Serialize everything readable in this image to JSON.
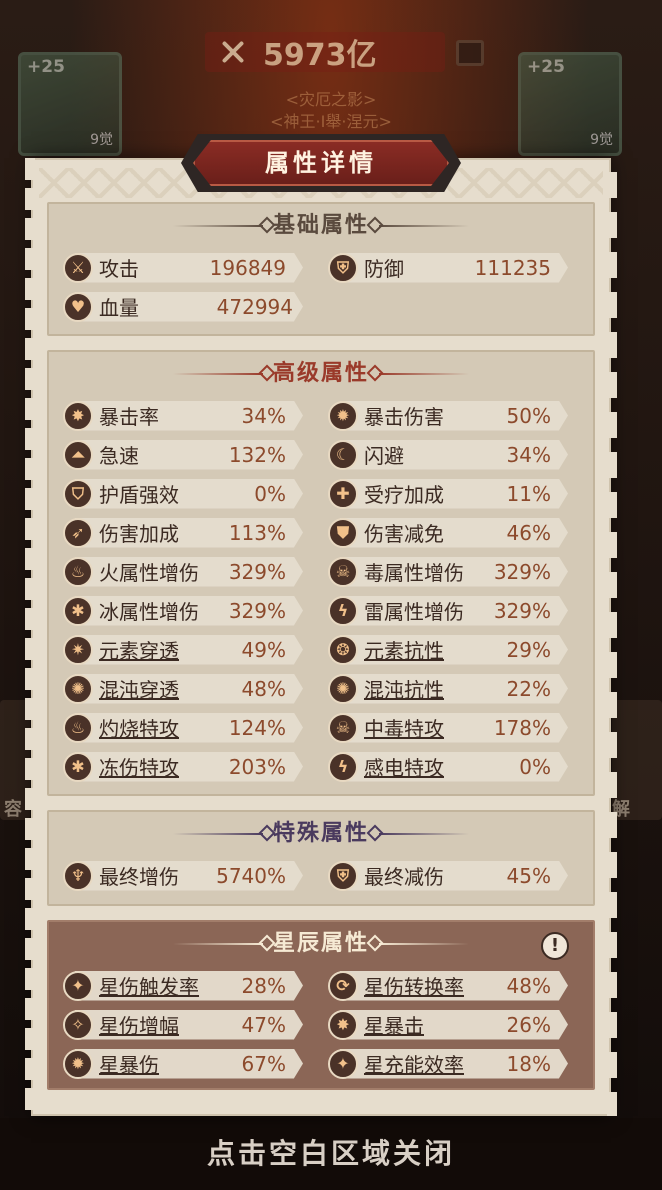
{
  "background": {
    "power_value": "5973亿",
    "subtitle_1": "<灾厄之影>",
    "subtitle_2": "<神王·I舉·涅元>",
    "left_card": {
      "level": "+25",
      "awaken": "9觉"
    },
    "right_card": {
      "level": "+25",
      "awaken": "9觉"
    },
    "side_left_text": "容",
    "side_right_text": "解"
  },
  "dialog": {
    "title": "属性详情",
    "close_hint": "点击空白区域关闭"
  },
  "sections": {
    "basic": {
      "title": "基础属性",
      "rows": [
        [
          {
            "icon": "sword-icon",
            "glyph": "⚔",
            "label": "攻击",
            "value": "196849"
          },
          {
            "icon": "shield-icon",
            "glyph": "⛨",
            "label": "防御",
            "value": "111235"
          }
        ],
        [
          {
            "icon": "heart-icon",
            "glyph": "♥",
            "label": "血量",
            "value": "472994"
          }
        ]
      ]
    },
    "advanced": {
      "title": "高级属性",
      "rows": [
        [
          {
            "icon": "crit-rate-icon",
            "glyph": "✸",
            "label": "暴击率",
            "value": "34%"
          },
          {
            "icon": "crit-damage-icon",
            "glyph": "✹",
            "label": "暴击伤害",
            "value": "50%"
          }
        ],
        [
          {
            "icon": "haste-icon",
            "glyph": "⏶",
            "label": "急速",
            "value": "132%"
          },
          {
            "icon": "dodge-icon",
            "glyph": "☾",
            "label": "闪避",
            "value": "34%"
          }
        ],
        [
          {
            "icon": "shield-boost-icon",
            "glyph": "⛉",
            "label": "护盾强效",
            "value": "0%"
          },
          {
            "icon": "healing-icon",
            "glyph": "✚",
            "label": "受疗加成",
            "value": "11%"
          }
        ],
        [
          {
            "icon": "damage-bonus-icon",
            "glyph": "➶",
            "label": "伤害加成",
            "value": "113%"
          },
          {
            "icon": "damage-reduction-icon",
            "glyph": "⛊",
            "label": "伤害减免",
            "value": "46%"
          }
        ],
        [
          {
            "icon": "fire-icon",
            "glyph": "♨",
            "label": "火属性增伤",
            "value": "329%"
          },
          {
            "icon": "poison-skull-icon",
            "glyph": "☠",
            "label": "毒属性增伤",
            "value": "329%"
          }
        ],
        [
          {
            "icon": "ice-icon",
            "glyph": "✱",
            "label": "冰属性增伤",
            "value": "329%"
          },
          {
            "icon": "lightning-icon",
            "glyph": "ϟ",
            "label": "雷属性增伤",
            "value": "329%"
          }
        ],
        [
          {
            "icon": "element-pierce-icon",
            "glyph": "✷",
            "label": "元素穿透",
            "value": "49%",
            "underline": true
          },
          {
            "icon": "element-resist-icon",
            "glyph": "❂",
            "label": "元素抗性",
            "value": "29%",
            "underline": true
          }
        ],
        [
          {
            "icon": "chaos-pierce-icon",
            "glyph": "✺",
            "label": "混沌穿透",
            "value": "48%",
            "underline": true
          },
          {
            "icon": "chaos-resist-icon",
            "glyph": "✺",
            "label": "混沌抗性",
            "value": "22%",
            "underline": true
          }
        ],
        [
          {
            "icon": "burn-icon",
            "glyph": "♨",
            "label": "灼烧特攻",
            "value": "124%",
            "underline": true
          },
          {
            "icon": "poison-icon",
            "glyph": "☠",
            "label": "中毒特攻",
            "value": "178%",
            "underline": true
          }
        ],
        [
          {
            "icon": "frostbite-icon",
            "glyph": "✱",
            "label": "冻伤特攻",
            "value": "203%",
            "underline": true
          },
          {
            "icon": "shock-icon",
            "glyph": "ϟ",
            "label": "感电特攻",
            "value": "0%",
            "underline": true
          }
        ]
      ]
    },
    "special": {
      "title": "特殊属性",
      "rows": [
        [
          {
            "icon": "final-damage-icon",
            "glyph": "♆",
            "label": "最终增伤",
            "value": "5740%"
          },
          {
            "icon": "final-reduction-icon",
            "glyph": "⛨",
            "label": "最终减伤",
            "value": "45%"
          }
        ]
      ]
    },
    "star": {
      "title": "星辰属性",
      "info_glyph": "!",
      "rows": [
        [
          {
            "icon": "star-trigger-icon",
            "glyph": "✦",
            "label": "星伤触发率",
            "value": "28%",
            "underline": true
          },
          {
            "icon": "star-convert-icon",
            "glyph": "⟳",
            "label": "星伤转换率",
            "value": "48%",
            "underline": true
          }
        ],
        [
          {
            "icon": "star-amplify-icon",
            "glyph": "✧",
            "label": "星伤增幅",
            "value": "47%",
            "underline": true
          },
          {
            "icon": "star-crit-icon",
            "glyph": "✸",
            "label": "星暴击",
            "value": "26%",
            "underline": true
          }
        ],
        [
          {
            "icon": "star-crit-damage-icon",
            "glyph": "✹",
            "label": "星暴伤",
            "value": "67%",
            "underline": true
          },
          {
            "icon": "star-energy-icon",
            "glyph": "✦",
            "label": "星充能效率",
            "value": "18%",
            "underline": true
          }
        ]
      ]
    }
  },
  "colors": {
    "basic_title": "#5a4a3e",
    "advanced_title": "#9a3a2a",
    "special_title": "#4a3a5e",
    "star_title": "#f6ead4"
  }
}
